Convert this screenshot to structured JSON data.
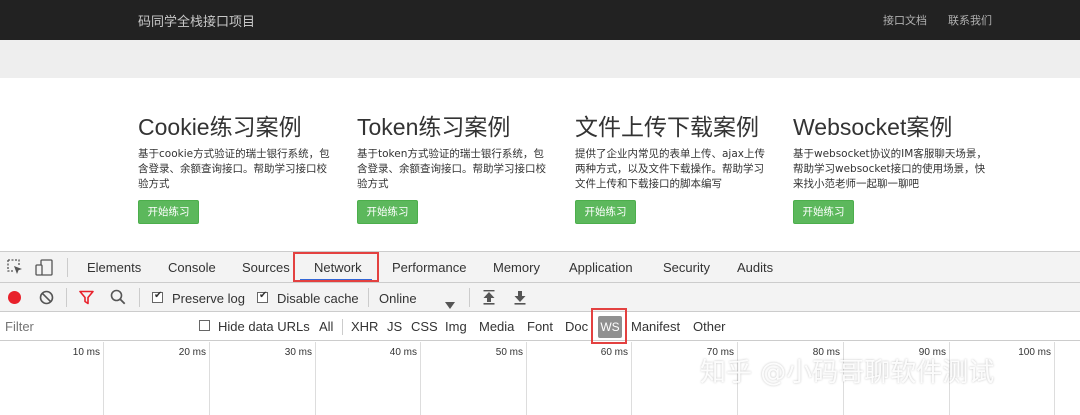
{
  "navbar": {
    "brand": "码同学全栈接口项目",
    "links": [
      "接口文档",
      "联系我们"
    ]
  },
  "cards": [
    {
      "title": "Cookie练习案例",
      "desc": "基于cookie方式验证的瑞士银行系统，包含登录、余额查询接口。帮助学习接口校验方式",
      "button": "开始练习"
    },
    {
      "title": "Token练习案例",
      "desc": "基于token方式验证的瑞士银行系统，包含登录、余额查询接口。帮助学习接口校验方式",
      "button": "开始练习"
    },
    {
      "title": "文件上传下载案例",
      "desc": "提供了企业内常见的表单上传、ajax上传两种方式，以及文件下载操作。帮助学习文件上传和下载接口的脚本编写",
      "button": "开始练习"
    },
    {
      "title": "Websocket案例",
      "desc": "基于websocket协议的IM客服聊天场景，帮助学习websocket接口的使用场景，快来找小范老师一起聊一聊吧",
      "button": "开始练习"
    }
  ],
  "devtools": {
    "tabs": [
      "Elements",
      "Console",
      "Sources",
      "Network",
      "Performance",
      "Memory",
      "Application",
      "Security",
      "Audits"
    ],
    "active_tab": "Network",
    "toolbar": {
      "preserve_log": "Preserve log",
      "disable_cache": "Disable cache",
      "throttle": "Online"
    },
    "filter": {
      "placeholder": "Filter",
      "hide_data_urls": "Hide data URLs",
      "types": [
        "All",
        "XHR",
        "JS",
        "CSS",
        "Img",
        "Media",
        "Font",
        "Doc",
        "WS",
        "Manifest",
        "Other"
      ],
      "selected_type": "WS"
    },
    "timeline_ticks": [
      "10 ms",
      "20 ms",
      "30 ms",
      "40 ms",
      "50 ms",
      "60 ms",
      "70 ms",
      "80 ms",
      "90 ms",
      "100 ms"
    ]
  },
  "watermark": "知乎 @小码哥聊软件测试",
  "colors": {
    "accent": "#3367d6",
    "highlight": "#e34140",
    "button": "#5cb85c",
    "record": "#e8212b"
  }
}
